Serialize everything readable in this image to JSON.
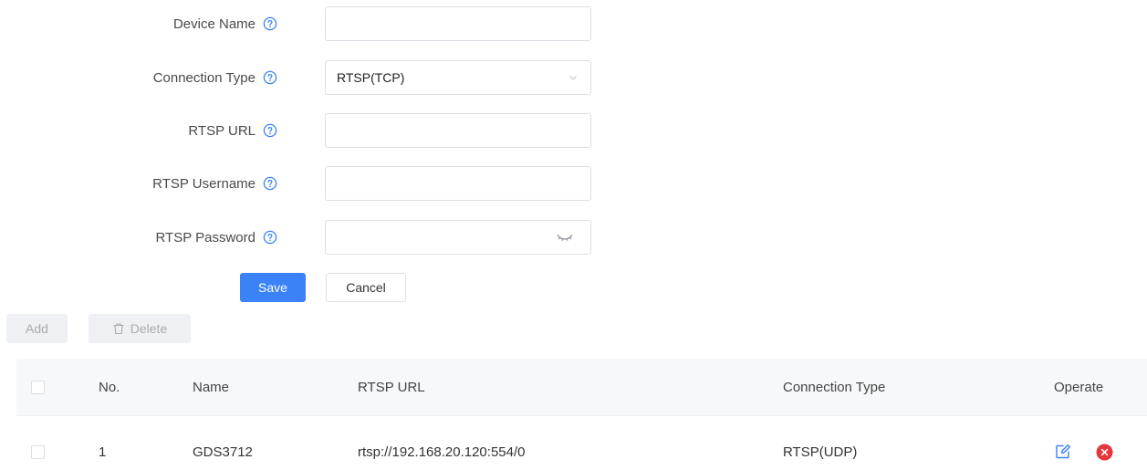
{
  "form": {
    "device_name": {
      "label": "Device Name",
      "value": "",
      "placeholder": ""
    },
    "connection_type": {
      "label": "Connection Type",
      "value": "RTSP(TCP)"
    },
    "rtsp_url": {
      "label": "RTSP URL",
      "value": "",
      "placeholder": ""
    },
    "rtsp_username": {
      "label": "RTSP Username",
      "value": "",
      "placeholder": ""
    },
    "rtsp_password": {
      "label": "RTSP Password",
      "value": "",
      "placeholder": ""
    },
    "save_label": "Save",
    "cancel_label": "Cancel"
  },
  "toolbar": {
    "add_label": "Add",
    "delete_label": "Delete"
  },
  "table": {
    "headers": {
      "no": "No.",
      "name": "Name",
      "rtsp_url": "RTSP URL",
      "connection_type": "Connection Type",
      "operate": "Operate"
    },
    "rows": [
      {
        "no": "1",
        "name": "GDS3712",
        "rtsp_url": "rtsp://192.168.20.120:554/0",
        "connection_type": "RTSP(UDP)"
      }
    ]
  },
  "icons": {
    "help": "question-circle-icon",
    "dropdown": "chevron-down-icon",
    "password_visibility": "eye-closed-icon",
    "trash": "trash-icon",
    "edit": "edit-icon",
    "remove": "close-circle-icon"
  },
  "colors": {
    "primary": "#3b82f6",
    "danger": "#e5383b",
    "disabled_bg": "#eef0f3",
    "disabled_text": "#a8abb2"
  }
}
